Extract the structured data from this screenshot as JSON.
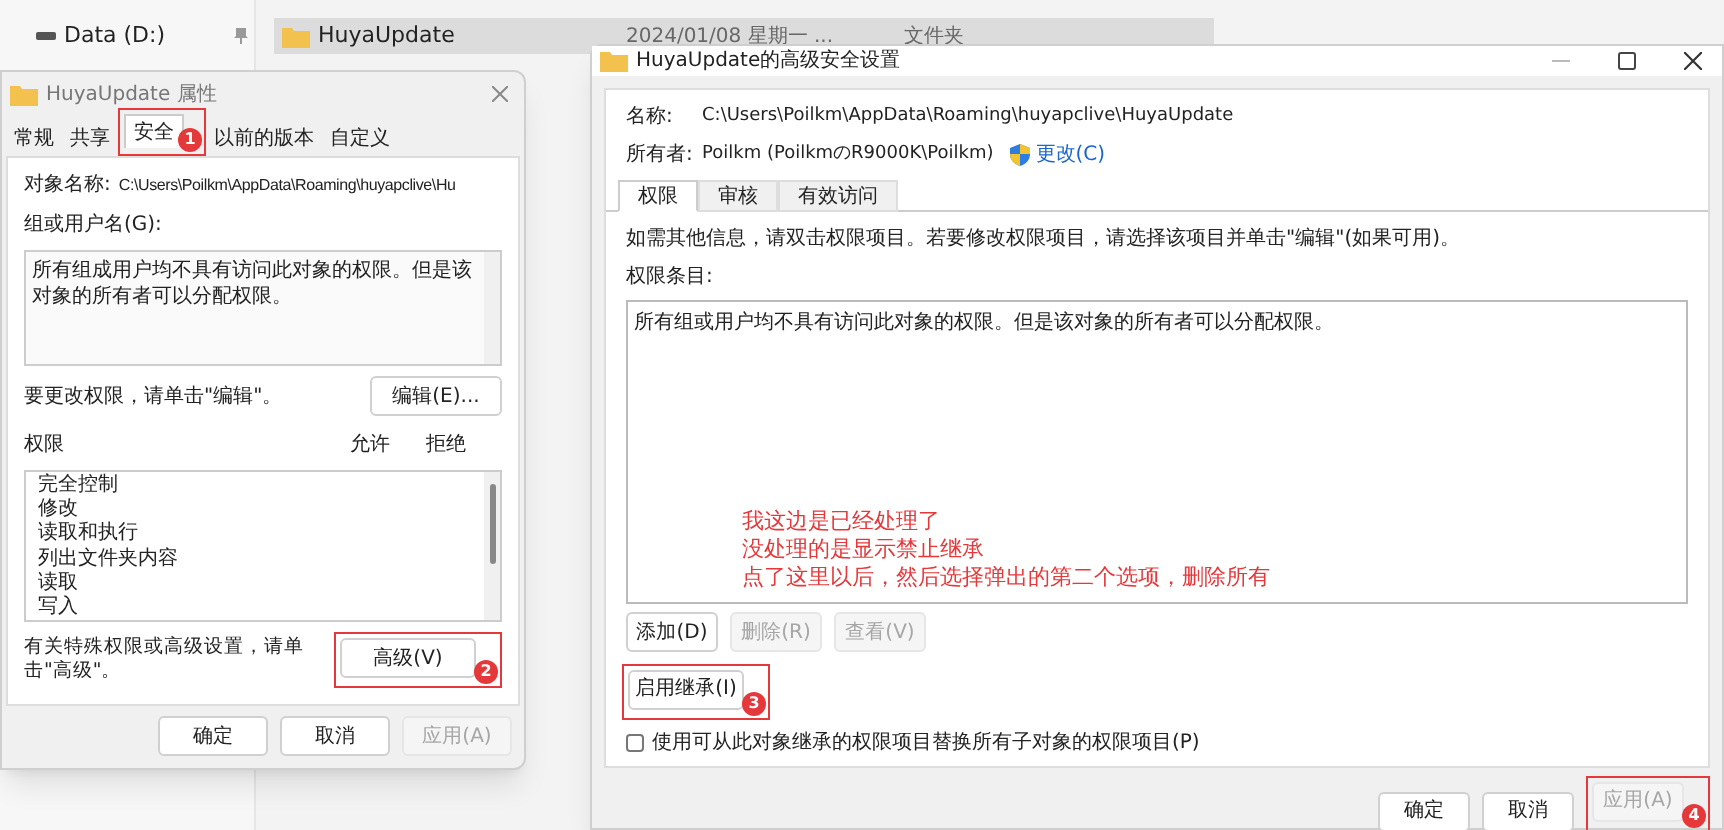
{
  "explorer": {
    "sidebar_items": [
      {
        "label": "Data (D:)"
      }
    ],
    "rows": [
      {
        "name": "HuyaUpdate",
        "date": "2024/01/08 星期一 ...",
        "type": "文件夹",
        "selected": true
      }
    ]
  },
  "properties_dialog": {
    "title": "HuyaUpdate 属性",
    "tabs": [
      {
        "label": "常规",
        "selected": false
      },
      {
        "label": "共享",
        "selected": false
      },
      {
        "label": "安全",
        "selected": true,
        "marker": "1"
      },
      {
        "label": "以前的版本",
        "selected": false
      },
      {
        "label": "自定义",
        "selected": false
      }
    ],
    "object_label": "对象名称:",
    "object_path": "C:\\Users\\Poilkm\\AppData\\Roaming\\huyapclive\\Hu",
    "groups_label": "组或用户名(G):",
    "groups_text": "所有组成用户均不具有访问此对象的权限。但是该对象的所有者可以分配权限。",
    "edit_hint": "要更改权限，请单击\"编辑\"。",
    "edit_button": "编辑(E)...",
    "permissions_columns": [
      "权限",
      "允许",
      "拒绝"
    ],
    "permissions": [
      "完全控制",
      "修改",
      "读取和执行",
      "列出文件夹内容",
      "读取",
      "写入"
    ],
    "advanced_hint": "有关特殊权限或高级设置，请单击\"高级\"。",
    "advanced_button": {
      "label": "高级(V)",
      "marker": "2"
    },
    "buttons": [
      {
        "label": "确定",
        "disabled": false
      },
      {
        "label": "取消",
        "disabled": false
      },
      {
        "label": "应用(A)",
        "disabled": true
      }
    ]
  },
  "advanced_dialog": {
    "title": "HuyaUpdate的高级安全设置",
    "name_label": "名称:",
    "name_value": "C:\\Users\\Poilkm\\AppData\\Roaming\\huyapclive\\HuyaUpdate",
    "owner_label": "所有者:",
    "owner_value": "Poilkm (PoilkmのR9000K\\Poilkm)",
    "change_link": "更改(C)",
    "tabs": [
      {
        "label": "权限",
        "selected": true
      },
      {
        "label": "审核",
        "selected": false
      },
      {
        "label": "有效访问",
        "selected": false
      }
    ],
    "info_text": "如需其他信息，请双击权限项目。若要修改权限项目，请选择该项目并单击\"编辑\"(如果可用)。",
    "entries_label": "权限条目:",
    "entries_text": "所有组或用户均不具有访问此对象的权限。但是该对象的所有者可以分配权限。",
    "note_lines": [
      "我这边是已经处理了",
      "没处理的是显示禁止继承",
      "点了这里以后，然后选择弹出的第二个选项，删除所有"
    ],
    "entry_buttons": [
      {
        "label": "添加(D)",
        "disabled": false
      },
      {
        "label": "删除(R)",
        "disabled": true
      },
      {
        "label": "查看(V)",
        "disabled": true
      }
    ],
    "inherit_button": {
      "label": "启用继承(I)",
      "marker": "3"
    },
    "replace_checkbox": {
      "label": "使用可从此对象继承的权限项目替换所有子对象的权限项目(P)",
      "checked": false
    },
    "buttons": [
      {
        "label": "确定",
        "disabled": false
      },
      {
        "label": "取消",
        "disabled": false
      },
      {
        "label": "应用(A)",
        "disabled": true,
        "marker": "4"
      }
    ]
  }
}
